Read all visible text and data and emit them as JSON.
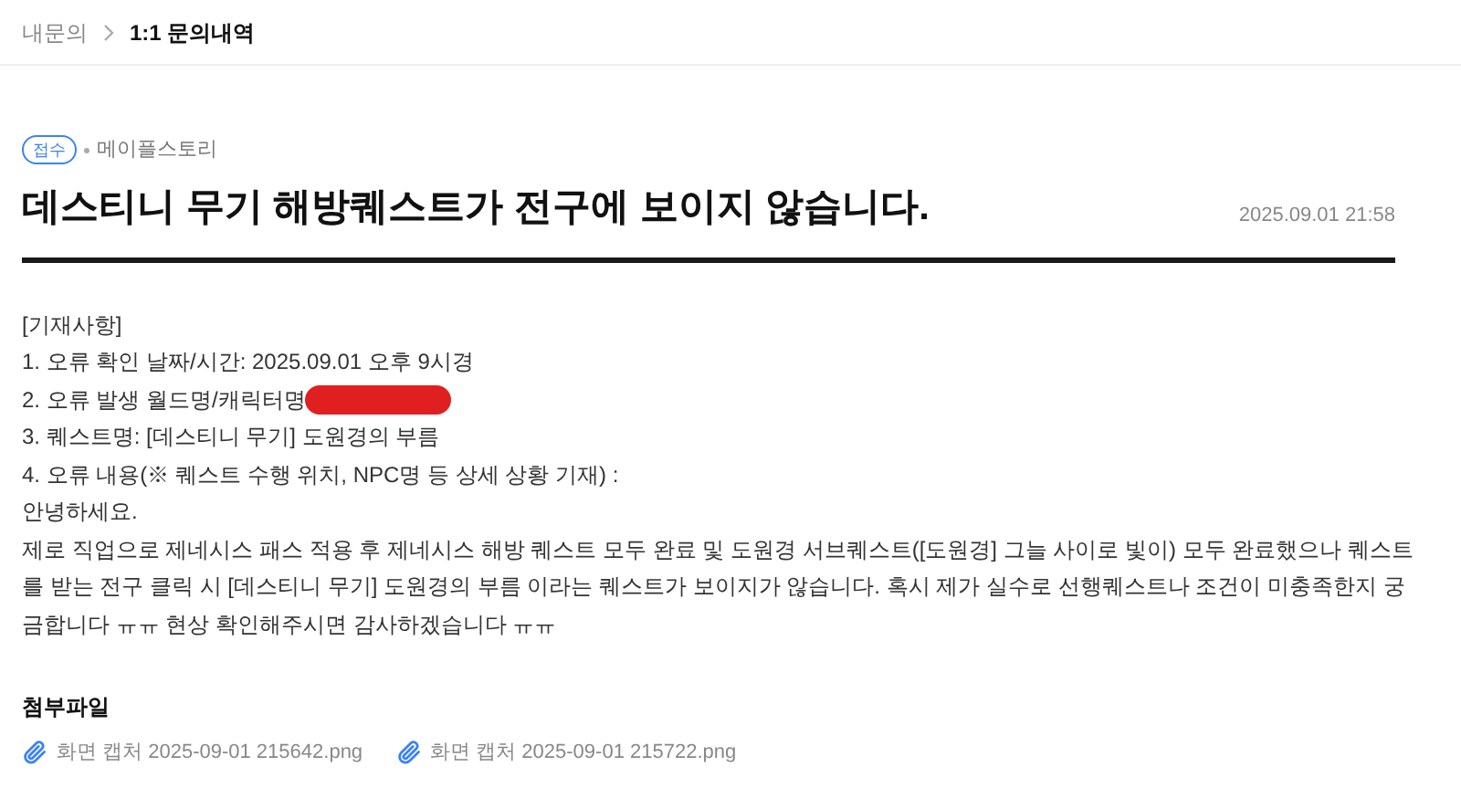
{
  "breadcrumb": {
    "parent": "내문의",
    "current": "1:1 문의내역"
  },
  "status_badge": "접수",
  "category": "메이플스토리",
  "title": "데스티니 무기 해방퀘스트가 전구에 보이지 않습니다.",
  "date": "2025.09.01 21:58",
  "body_lines": [
    {
      "kind": "text",
      "text": "[기재사항]"
    },
    {
      "kind": "text",
      "text": "1. 오류 확인 날짜/시간: 2025.09.01 오후 9시경"
    },
    {
      "kind": "redacted",
      "text": "2. 오류 발생 월드명/캐릭터명"
    },
    {
      "kind": "text",
      "text": "3. 퀘스트명: [데스티니 무기] 도원경의 부름"
    },
    {
      "kind": "text",
      "text": "4. 오류 내용(※ 퀘스트 수행 위치, NPC명 등 상세 상황 기재) :"
    },
    {
      "kind": "text",
      "text": "안녕하세요."
    },
    {
      "kind": "text",
      "text": "제로 직업으로 제네시스 패스 적용 후 제네시스 해방 퀘스트 모두 완료 및 도원경 서브퀘스트([도원경] 그늘 사이로 빛이) 모두 완료했으나 퀘스트를 받는 전구 클릭 시 [데스티니 무기] 도원경의 부름 이라는 퀘스트가 보이지가 않습니다. 혹시 제가 실수로 선행퀘스트나 조건이 미충족한지 궁금합니다 ㅠㅠ 현상 확인해주시면 감사하겠습니다 ㅠㅠ"
    }
  ],
  "attachments": {
    "title": "첨부파일",
    "files": [
      "화면 캡처 2025-09-01 215642.png",
      "화면 캡처 2025-09-01 215722.png"
    ]
  }
}
